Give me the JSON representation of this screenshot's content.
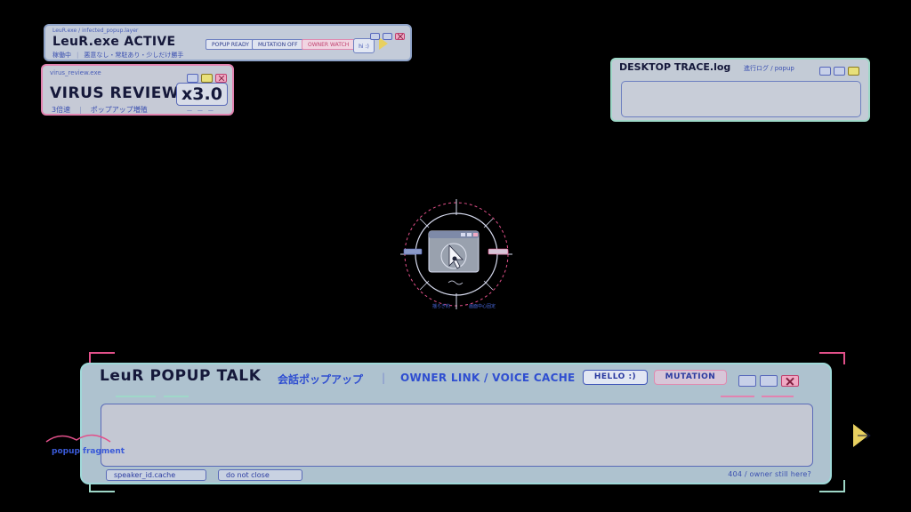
{
  "status_window": {
    "caption": "LeuR.exe / infected_popup.layer",
    "title": "LeuR.exe ACTIVE",
    "state": "稼働中",
    "description": "悪意なし・常駐あり・少しだけ勝手",
    "chips": [
      "POPUP READY",
      "MUTATION OFF",
      "OWNER WATCH"
    ],
    "hi_label": "hi :)"
  },
  "virus_window": {
    "caption": "virus_review.exe",
    "title": "VIRUS REVIEW",
    "speed": "x3.0",
    "speed_dashes": "— — —",
    "sub_speed": "3倍速",
    "sub_desc": "ポップアップ増殖"
  },
  "trace_window": {
    "title": "DESKTOP TRACE.log",
    "subtitle": "進行ログ / popup"
  },
  "reticle": {
    "caption_left": "揺らぎ約",
    "caption_right": "画面中心固定"
  },
  "talk_window": {
    "title": "LeuR POPUP TALK",
    "sub_jp": "会話ポップアップ",
    "separator": "|",
    "sub_en": "OWNER LINK / VOICE CACHE",
    "hello_button": "HELLO :)",
    "mutation_button": "MUTATION",
    "footer_chips": [
      "speaker_id.cache",
      "do not close"
    ],
    "footer_status": "404 / owner still here?"
  },
  "fragment": {
    "label": "popup fragment"
  },
  "colors": {
    "background": "#000000",
    "accent_pink": "#e2508a",
    "accent_mint": "#9fd8c8",
    "accent_blue": "#2f4ed0",
    "accent_yellow": "#e8d060"
  },
  "icons": [
    "minimize-icon",
    "maximize-icon",
    "close-icon",
    "cursor-icon",
    "arrow-right-icon"
  ]
}
